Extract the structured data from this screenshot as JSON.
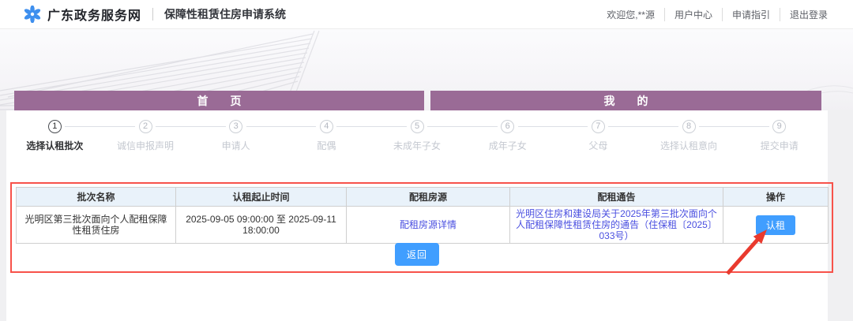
{
  "header": {
    "site_title": "广东政务服务网",
    "app_title": "保障性租赁住房申请系统",
    "welcome": "欢迎您,**源",
    "links": {
      "user_center": "用户中心",
      "guide": "申请指引",
      "logout": "退出登录"
    }
  },
  "tabs": {
    "home": "首　　页",
    "mine": "我　　的"
  },
  "steps": [
    {
      "num": "1",
      "label": "选择认租批次",
      "active": true
    },
    {
      "num": "2",
      "label": "诚信申报声明",
      "active": false
    },
    {
      "num": "3",
      "label": "申请人",
      "active": false
    },
    {
      "num": "4",
      "label": "配偶",
      "active": false
    },
    {
      "num": "5",
      "label": "未成年子女",
      "active": false
    },
    {
      "num": "6",
      "label": "成年子女",
      "active": false
    },
    {
      "num": "7",
      "label": "父母",
      "active": false
    },
    {
      "num": "8",
      "label": "选择认租意向",
      "active": false
    },
    {
      "num": "9",
      "label": "提交申请",
      "active": false
    }
  ],
  "table": {
    "headers": [
      "批次名称",
      "认租起止时间",
      "配租房源",
      "配租通告",
      "操作"
    ],
    "rows": [
      {
        "batch_name": "光明区第三批次面向个人配租保障性租赁住房",
        "time_range": "2025-09-05 09:00:00 至 2025-09-11 18:00:00",
        "house_link": "配租房源详情",
        "notice_link": "光明区住房和建设局关于2025年第三批次面向个人配租保障性租赁住房的通告（住保租〔2025〕033号）",
        "action_label": "认租"
      }
    ]
  },
  "buttons": {
    "back": "返回"
  },
  "colors": {
    "tab_purple": "#9a6b96",
    "primary_blue": "#409eff",
    "link_blue": "#4a4fe0",
    "table_header_bg": "#e9f2fa",
    "annotation_red": "#f7524a",
    "logo_blue": "#3e8fee"
  }
}
